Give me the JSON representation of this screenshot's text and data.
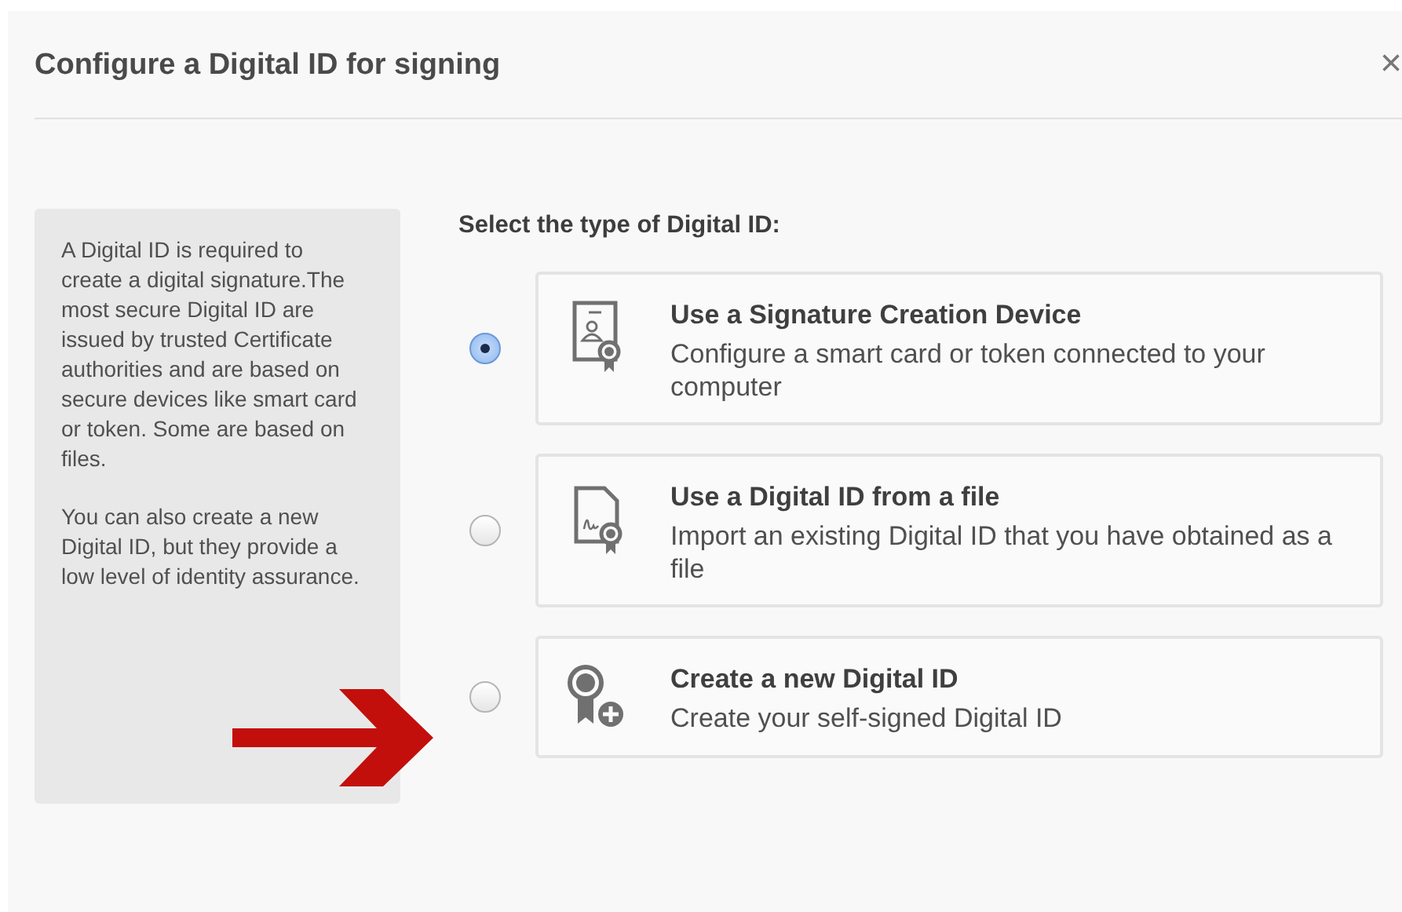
{
  "dialog": {
    "title": "Configure a Digital ID for signing",
    "close": "×"
  },
  "info": {
    "paragraphs": [
      "A Digital ID is required to create a digital signature.The most secure Digital ID are issued by trusted Certificate authorities and are based on secure devices like smart card or token. Some are based on files.",
      "You can also create a new Digital ID, but they provide a low level of identity assurance."
    ]
  },
  "prompt": "Select the type of Digital ID:",
  "options": [
    {
      "kind": "device",
      "title": "Use a Signature Creation Device",
      "description": "Configure a smart card or token connected to your computer",
      "selected": true
    },
    {
      "kind": "file",
      "title": "Use a Digital ID from a file",
      "description": "Import an existing Digital ID that you have obtained as a file",
      "selected": false
    },
    {
      "kind": "new",
      "title": "Create a new Digital ID",
      "description": "Create your self-signed Digital ID",
      "selected": false
    }
  ]
}
